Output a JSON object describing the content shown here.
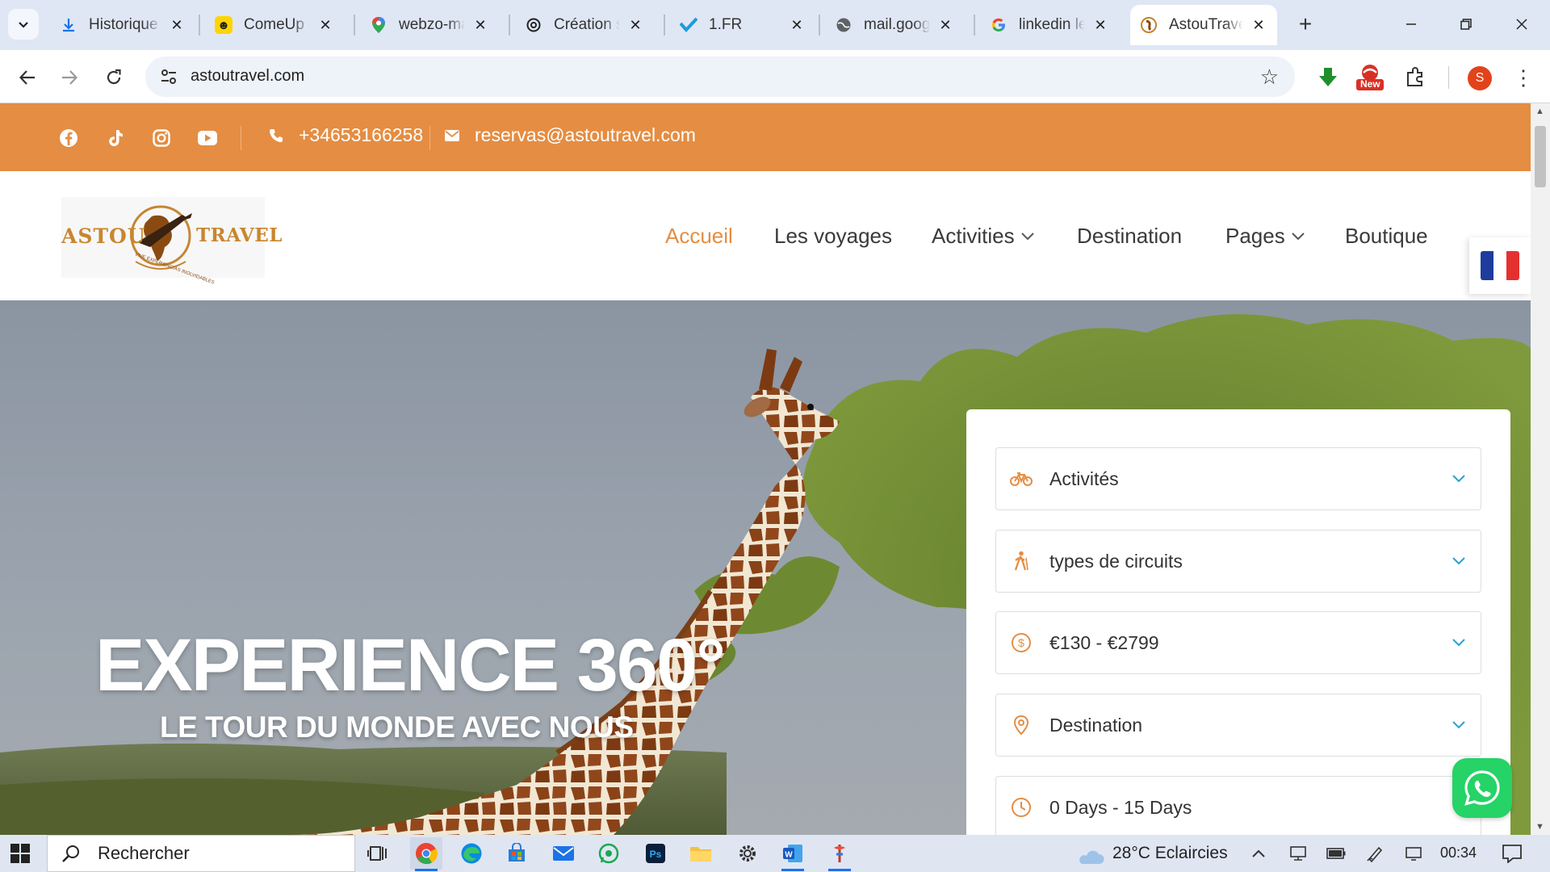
{
  "browser": {
    "tabs": [
      {
        "title": "Historique",
        "icon": "download-icon",
        "active": false
      },
      {
        "title": "ComeUp -",
        "icon": "comeup-icon",
        "active": false
      },
      {
        "title": "webzo-ma",
        "icon": "maps-pin-icon",
        "active": false
      },
      {
        "title": "Création si",
        "icon": "openai-icon",
        "active": false
      },
      {
        "title": "1.FR",
        "icon": "checkmark-brand-icon",
        "active": false
      },
      {
        "title": "mail.googl",
        "icon": "globe-icon",
        "active": false
      },
      {
        "title": "linkedin le",
        "icon": "google-icon",
        "active": false
      },
      {
        "title": "AstouTrave",
        "icon": "astou-favicon",
        "active": true
      }
    ],
    "address": "astoutravel.com",
    "extension_badge": "New",
    "profile_initial": "S"
  },
  "site": {
    "topbar": {
      "phone": "+34653166258",
      "email": "reservas@astoutravel.com",
      "socials": [
        "facebook-icon",
        "tiktok-icon",
        "instagram-icon",
        "youtube-icon"
      ]
    },
    "logo": {
      "left": "ASTOU",
      "right": "TRAVEL",
      "tagline": "VIVE EXPERIENCIAS INOLVIDABLES"
    },
    "nav": [
      {
        "label": "Accueil",
        "current": true,
        "dropdown": false
      },
      {
        "label": "Les voyages",
        "current": false,
        "dropdown": false
      },
      {
        "label": "Activities",
        "current": false,
        "dropdown": true
      },
      {
        "label": "Destination",
        "current": false,
        "dropdown": false
      },
      {
        "label": "Pages",
        "current": false,
        "dropdown": true
      },
      {
        "label": "Boutique",
        "current": false,
        "dropdown": false
      }
    ],
    "hero": {
      "title": "EXPERIENCE 360°",
      "subtitle": "LE TOUR DU MONDE AVEC NOUS"
    },
    "search": {
      "fields": [
        {
          "label": "Activités",
          "icon": "bicycle-icon"
        },
        {
          "label": "types de circuits",
          "icon": "hiker-icon"
        },
        {
          "label": "€130 - €2799",
          "icon": "dollar-circle-icon"
        },
        {
          "label": "Destination",
          "icon": "location-pin-icon"
        },
        {
          "label": "0 Days - 15 Days",
          "icon": "clock-icon"
        }
      ]
    }
  },
  "taskbar": {
    "search_placeholder": "Rechercher",
    "weather": "28°C  Eclaircies",
    "time": "00:34"
  },
  "colors": {
    "accent": "#e58d42",
    "topbar": "#e58d42",
    "whatsapp": "#25d366"
  }
}
